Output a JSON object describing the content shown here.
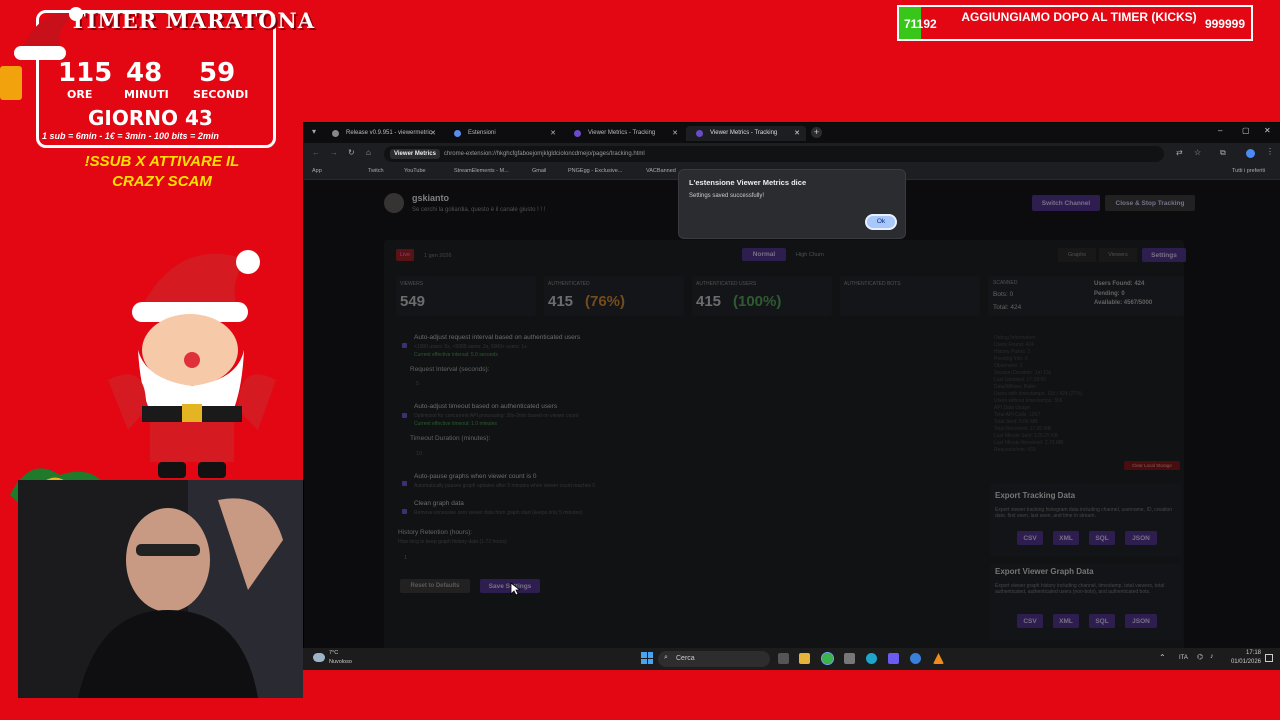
{
  "overlay": {
    "timer_title": "TIMER MARATONA",
    "hours": "115",
    "minutes": "48",
    "seconds": "59",
    "hours_label": "ORE",
    "minutes_label": "MINUTI",
    "seconds_label": "SECONDI",
    "day": "GIORNO 43",
    "rates": "1 sub = 6min - 1€ = 3min - 100 bits = 2min",
    "promo": "!SSUB X ATTIVARE IL CRAZY SCAM",
    "goal_current": "71192",
    "goal_text": "AGGIUNGIAMO DOPO AL TIMER (KICKS)",
    "goal_max": "999999"
  },
  "browser": {
    "tabs": [
      {
        "label": "Release v0.9.951 - viewermetric",
        "active": false
      },
      {
        "label": "Estensioni",
        "active": false
      },
      {
        "label": "Viewer Metrics - Tracking",
        "active": false
      },
      {
        "label": "Viewer Metrics - Tracking",
        "active": true
      }
    ],
    "url_host": "Viewer Metrics",
    "url": "chrome-extension://hkghcfgfaboejomjklgldcioloncdmejo/pages/tracking.html",
    "bookmarks": [
      "App",
      "Twitch",
      "YouTube",
      "StreamElements - M...",
      "Gmail",
      "PNGEgg - Exclusive...",
      "VACBanned",
      "Tutti i preferiti"
    ]
  },
  "app": {
    "channel": "gskianto",
    "tagline": "Se cerchi la goliardia, questo è il canale giusto ! ! !",
    "switch_channel": "Switch Channel",
    "close_stop": "Close & Stop Tracking",
    "live_badge": "Live",
    "date": "1 gen 2026",
    "mode_normal": "Normal",
    "mode_high": "High Churn",
    "view_tabs": [
      "Graphs",
      "Viewers",
      "Settings"
    ],
    "stats": {
      "viewers_label": "VIEWERS",
      "viewers": "549",
      "auth_label": "AUTHENTICATED",
      "auth": "415",
      "auth_pct": "(76%)",
      "auth_users_label": "AUTHENTICATED USERS",
      "auth_users": "415",
      "auth_users_pct": "(100%)",
      "auth_bots_label": "AUTHENTICATED BOTS",
      "scanned_label": "SCANNED",
      "bots": "Bots: 0",
      "total": "Total: 424",
      "users_found": "Users Found: 424",
      "pending": "Pending: 0",
      "available": "Available: 4567/5000"
    },
    "settings": {
      "auto_interval": "Auto-adjust request interval based on authenticated users",
      "auto_interval_hint": "<1000 users: 5s, <5000 users: 2s, 5000+ users: 1s",
      "current_interval": "Current effective interval: 5.0 seconds",
      "request_interval_label": "Request Interval (seconds):",
      "request_interval_value": "5",
      "auto_timeout": "Auto-adjust timeout based on authenticated users",
      "auto_timeout_hint": "Optimized for concurrent API processing: 30s-2min based on viewer count",
      "current_timeout": "Current effective timeout: 1.0 minutes",
      "timeout_label": "Timeout Duration (minutes):",
      "timeout_value": "10",
      "auto_pause": "Auto-pause graphs when viewer count is 0",
      "auto_pause_hint": "Automatically pauses graph updates after 5 minutes when viewer count reaches 0",
      "clean_graph": "Clean graph data",
      "clean_graph_hint": "Remove excessive zero viewer data from graph start (keeps only 5 minutes)",
      "history_label": "History Retention (hours):",
      "history_hint": "How long to keep graph history data (1-72 hours)",
      "history_value": "1",
      "reset": "Reset to Defaults",
      "save": "Save Settings"
    },
    "debug": [
      "Debug Information:",
      "Users Found: 424",
      "History Points: 2",
      "Pending Info: 0",
      "Observers: 2",
      "Session Duration: 1m 13s",
      "Last Updated: 17:18:50",
      "Data/Millisec Ratio:",
      "Users with timestamps: 118 / 424 (27%)",
      "Users without timestamps: 306",
      "API Data Usage:",
      "Total API Calls: 1067",
      "Total Sent: 5.06 MB",
      "Total Received: 17.26 MB",
      "Last Minute Sent: 129.25 KB",
      "Last Minute Received: 2.73 MB",
      "Requests/min: 433"
    ],
    "clear_storage": "Clear Local Storage",
    "export_tracking_title": "Export Tracking Data",
    "export_tracking_desc": "Export viewer tracking histogram data including channel, username, ID, creation date, first seen, last seen, and time in stream.",
    "export_graph_title": "Export Viewer Graph Data",
    "export_graph_desc": "Export viewer graph history including channel, timestamp, total viewers, total authenticated, authenticated users (non-bots), and authenticated bots.",
    "export_buttons": [
      "CSV",
      "XML",
      "SQL",
      "JSON"
    ]
  },
  "dialog": {
    "title": "L'estensione Viewer Metrics dice",
    "message": "Settings saved successfully!",
    "ok": "Ok"
  },
  "taskbar": {
    "weather_temp": "7°C",
    "weather_desc": "Nuvoloso",
    "search": "Cerca",
    "lang": "ITA",
    "time": "17:18",
    "date": "01/01/2026"
  },
  "colors": {
    "overlay_red": "#e30613",
    "accent_purple": "#4b2d85",
    "goal_green": "#39c61a",
    "promo_yellow": "#ffe100"
  }
}
